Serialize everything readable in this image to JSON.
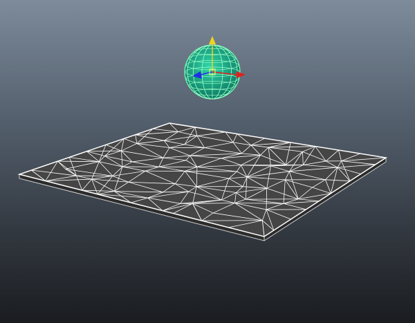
{
  "viewport": {
    "background_top": "#7d8b9b",
    "background_bottom": "#1a1c20"
  },
  "colors": {
    "plane_fill": "#454545",
    "plane_edge": "#ffffff",
    "plane_side": "#b8b8b8",
    "sphere_fill": "#16a085",
    "sphere_wire": "#7dffb8",
    "axis_y": "#f1d21e",
    "axis_x": "#e02020",
    "axis_z": "#2030e0"
  },
  "objects": {
    "sphere": {
      "type": "polySphere",
      "selected": true
    },
    "plane": {
      "type": "polyPlane",
      "style": "wireframe-on-shaded"
    },
    "manipulator": {
      "type": "move",
      "axes": [
        "x",
        "y",
        "z"
      ]
    }
  }
}
